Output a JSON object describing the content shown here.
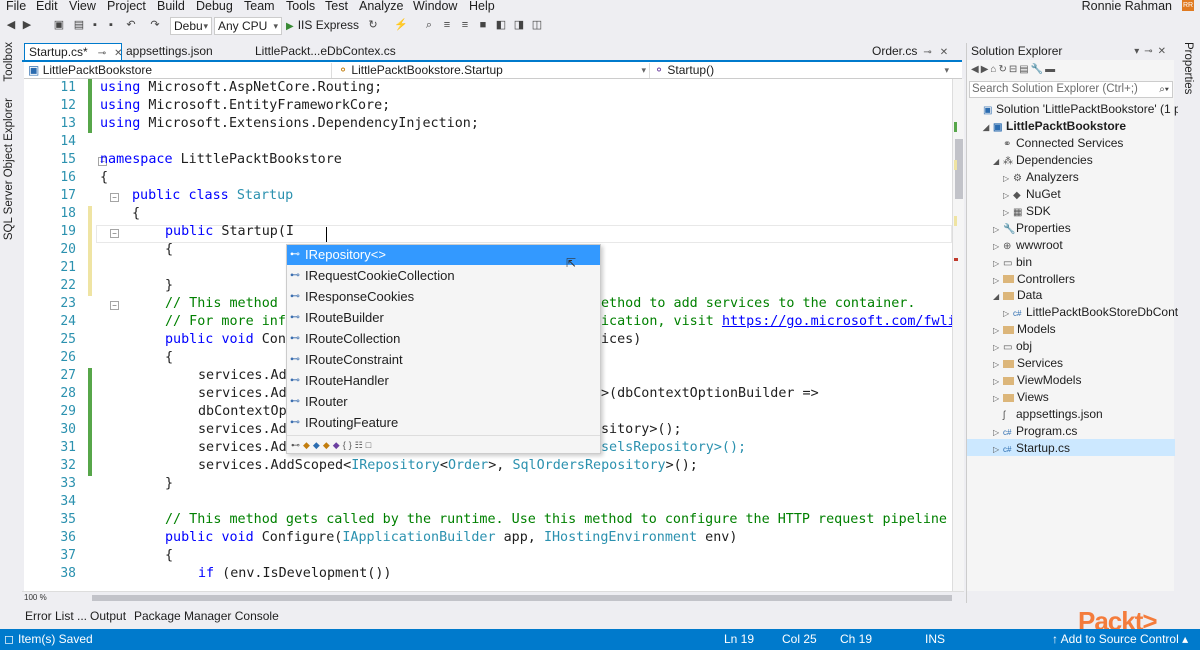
{
  "menu": [
    "File",
    "Edit",
    "View",
    "Project",
    "Build",
    "Debug",
    "Team",
    "Tools",
    "Test",
    "Analyze",
    "Window",
    "Help"
  ],
  "user": {
    "name": "Ronnie Rahman"
  },
  "toolbar": {
    "config": "Debu",
    "platform": "Any CPU",
    "run_target": "IIS Express"
  },
  "left_tool_tabs": [
    "Toolbox",
    "SQL Server Object Explorer"
  ],
  "right_tool_tabs": [
    "Properties"
  ],
  "doc_tabs": [
    {
      "label": "Startup.cs*",
      "active": true
    },
    {
      "label": "appsettings.json",
      "active": false
    },
    {
      "label": "LittlePackt...eDbContex.cs",
      "active": false
    },
    {
      "label": "Order.cs",
      "active": false
    }
  ],
  "navbar": {
    "project": "LittlePacktBookstore",
    "type": "LittlePacktBookstore.Startup",
    "member": "Startup()"
  },
  "code": {
    "line_numbers": [
      "11",
      "12",
      "13",
      "14",
      "15",
      "16",
      "17",
      "18",
      "19",
      "20",
      "21",
      "22",
      "23",
      "24",
      "25",
      "26",
      "27",
      "28",
      "29",
      "30",
      "31",
      "32",
      "33",
      "34",
      "35",
      "36",
      "37",
      "38"
    ],
    "l11": [
      "using",
      " Microsoft.AspNetCore.Routing;"
    ],
    "l12": [
      "using",
      " Microsoft.EntityFrameworkCore;"
    ],
    "l13": [
      "using",
      " Microsoft.Extensions.DependencyInjection;"
    ],
    "l15": [
      "namespace",
      " LittlePacktBookstore"
    ],
    "l16": "{",
    "l17": [
      "public",
      "class",
      "Startup"
    ],
    "l18": "{",
    "l19": [
      "public",
      " Startup(I"
    ],
    "l20": "{",
    "l22": "}",
    "l23a": "// This method ",
    "l23b": "ethod to add services to the container.",
    "l24a": "// For more inf",
    "l24b": "ication, visit ",
    "l24c": "https://go.microsoft.com/fwli",
    "l25a": [
      "public",
      "void",
      " Con"
    ],
    "l25b": "ices)",
    "l26": "{",
    "l27": "services.Ad",
    "l28a": "services.Ad",
    "l28b": ">(dbContextOptionBuilder =>",
    "l29": "dbContextOp",
    "l30a": "services.Ad",
    "l30b": "sitory>();",
    "l31a": "services.Ad",
    "l31b": "selsRepository>();",
    "l32": [
      "services.AddScoped<",
      "IRepository",
      "<",
      "Order",
      ">, ",
      "SqlOrdersRepository",
      ">();"
    ],
    "l33": "}",
    "l35": "// This method gets called by the runtime. Use this method to configure the HTTP request pipeline",
    "l36": [
      "public",
      "void",
      " Configure(",
      "IApplicationBuilder",
      " app, ",
      "IHostingEnvironment",
      " env)"
    ],
    "l37": "{",
    "l38": [
      "if",
      " (env.IsDevelopment())"
    ]
  },
  "intellisense": {
    "items": [
      "IRepository<>",
      "IRequestCookieCollection",
      "IResponseCookies",
      "IRouteBuilder",
      "IRouteCollection",
      "IRouteConstraint",
      "IRouteHandler",
      "IRouter",
      "IRoutingFeature"
    ],
    "selected_index": 0
  },
  "solution_explorer": {
    "title": "Solution Explorer",
    "search_placeholder": "Search Solution Explorer (Ctrl+;)",
    "nodes": [
      {
        "label": "Solution 'LittlePacktBookstore' (1 pr",
        "indent": 0,
        "exp": "",
        "icon": "solution-icon"
      },
      {
        "label": "LittlePacktBookstore",
        "indent": 1,
        "exp": "◢",
        "icon": "project-icon",
        "bold": true
      },
      {
        "label": "Connected Services",
        "indent": 2,
        "exp": "",
        "icon": "connected-services-icon"
      },
      {
        "label": "Dependencies",
        "indent": 2,
        "exp": "◢",
        "icon": "dependencies-icon"
      },
      {
        "label": "Analyzers",
        "indent": 3,
        "exp": "▷",
        "icon": "analyzers-icon"
      },
      {
        "label": "NuGet",
        "indent": 3,
        "exp": "▷",
        "icon": "nuget-icon"
      },
      {
        "label": "SDK",
        "indent": 3,
        "exp": "▷",
        "icon": "sdk-icon"
      },
      {
        "label": "Properties",
        "indent": 2,
        "exp": "▷",
        "icon": "wrench-icon"
      },
      {
        "label": "wwwroot",
        "indent": 2,
        "exp": "▷",
        "icon": "globe-icon"
      },
      {
        "label": "bin",
        "indent": 2,
        "exp": "▷",
        "icon": "folder-outline-icon"
      },
      {
        "label": "Controllers",
        "indent": 2,
        "exp": "▷",
        "icon": "folder-icon"
      },
      {
        "label": "Data",
        "indent": 2,
        "exp": "◢",
        "icon": "folder-icon"
      },
      {
        "label": "LittlePacktBookStoreDbConte",
        "indent": 3,
        "exp": "▷",
        "icon": "csharp-icon"
      },
      {
        "label": "Models",
        "indent": 2,
        "exp": "▷",
        "icon": "folder-icon"
      },
      {
        "label": "obj",
        "indent": 2,
        "exp": "▷",
        "icon": "folder-outline-icon"
      },
      {
        "label": "Services",
        "indent": 2,
        "exp": "▷",
        "icon": "folder-icon"
      },
      {
        "label": "ViewModels",
        "indent": 2,
        "exp": "▷",
        "icon": "folder-icon"
      },
      {
        "label": "Views",
        "indent": 2,
        "exp": "▷",
        "icon": "folder-icon"
      },
      {
        "label": "appsettings.json",
        "indent": 2,
        "exp": "",
        "icon": "json-icon"
      },
      {
        "label": "Program.cs",
        "indent": 2,
        "exp": "▷",
        "icon": "csharp-icon"
      },
      {
        "label": "Startup.cs",
        "indent": 2,
        "exp": "▷",
        "icon": "csharp-icon",
        "selected": true
      }
    ]
  },
  "zoom": "100 %",
  "bottom_tabs": [
    "Error List ...",
    "Output",
    "Package Manager Console"
  ],
  "status": {
    "message": "Item(s) Saved",
    "ln": "Ln 19",
    "col": "Col 25",
    "ch": "Ch 19",
    "mode": "INS",
    "source_control": "Add to Source Control"
  },
  "brand": {
    "logo_text": "Packt>"
  },
  "colors": {
    "accent": "#007acc",
    "keyword": "#0000ff",
    "type": "#2b91af",
    "comment": "#008000",
    "selection": "#3399ff",
    "logo": "#f47c3c"
  }
}
